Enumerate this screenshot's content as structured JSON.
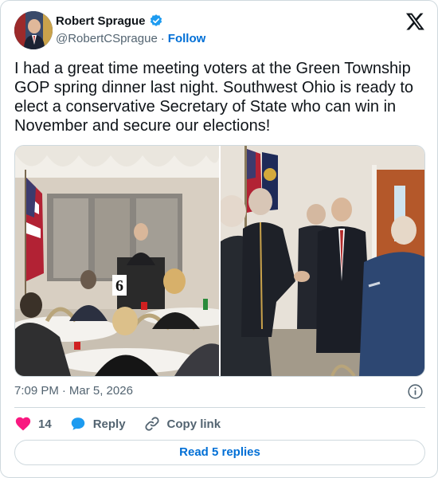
{
  "author": {
    "name": "Robert Sprague",
    "handle": "@RobertCSprague",
    "separator": "·",
    "follow_label": "Follow"
  },
  "tweet": {
    "text": "I had a great time meeting voters at the Green Township GOP spring dinner last night. Southwest Ohio is ready to elect a conservative Secretary of State who can win in November and secure our elections!",
    "time": "7:09 PM",
    "separator": "·",
    "date": "Mar 5, 2026"
  },
  "actions": {
    "like_count": "14",
    "reply_label": "Reply",
    "copy_label": "Copy link"
  },
  "read_replies_label": "Read 5 replies",
  "icons": {
    "verified": "verified-badge-icon",
    "brand": "x-logo-icon",
    "info": "info-icon",
    "like": "heart-icon",
    "reply": "speech-bubble-icon",
    "copy": "link-icon"
  },
  "colors": {
    "accent": "#1d9bf0",
    "link": "#006fd6",
    "like": "#f91880",
    "text": "#0f1419",
    "muted": "#536471",
    "border": "#cfd9de"
  }
}
